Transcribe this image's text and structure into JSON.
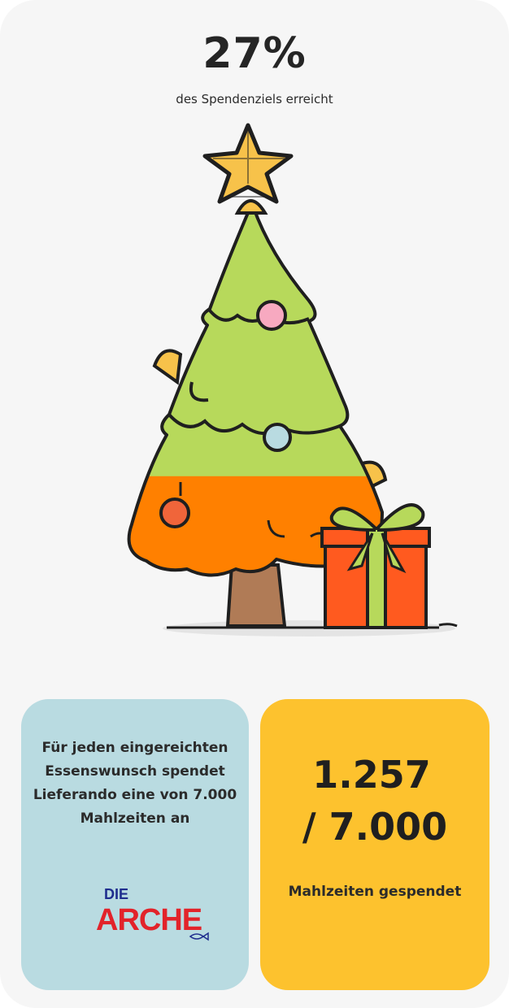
{
  "progress": {
    "percent_label": "27%",
    "percent_value": 27,
    "subtitle": "des Spendenziels erreicht"
  },
  "info_panel": {
    "text": "Für jeden eingereichten Essenswunsch spendet Lieferando eine von 7.000 Mahlzeiten an",
    "logo": {
      "line1": "DIE",
      "line2": "ARCHE"
    }
  },
  "counter_panel": {
    "current": "1.257",
    "target": "/ 7.000",
    "label": "Mahlzeiten gespendet"
  },
  "colors": {
    "background": "#f6f6f6",
    "tree_green": "#b7d95b",
    "tree_orange": "#ff8000",
    "info_panel": "#b9dbe1",
    "counter_panel": "#fdc22e",
    "gift_red": "#ff5a1f",
    "star_yellow": "#f7c24a"
  },
  "icons": [
    "christmas-tree-icon",
    "star-icon",
    "gift-box-icon",
    "die-arche-logo"
  ]
}
